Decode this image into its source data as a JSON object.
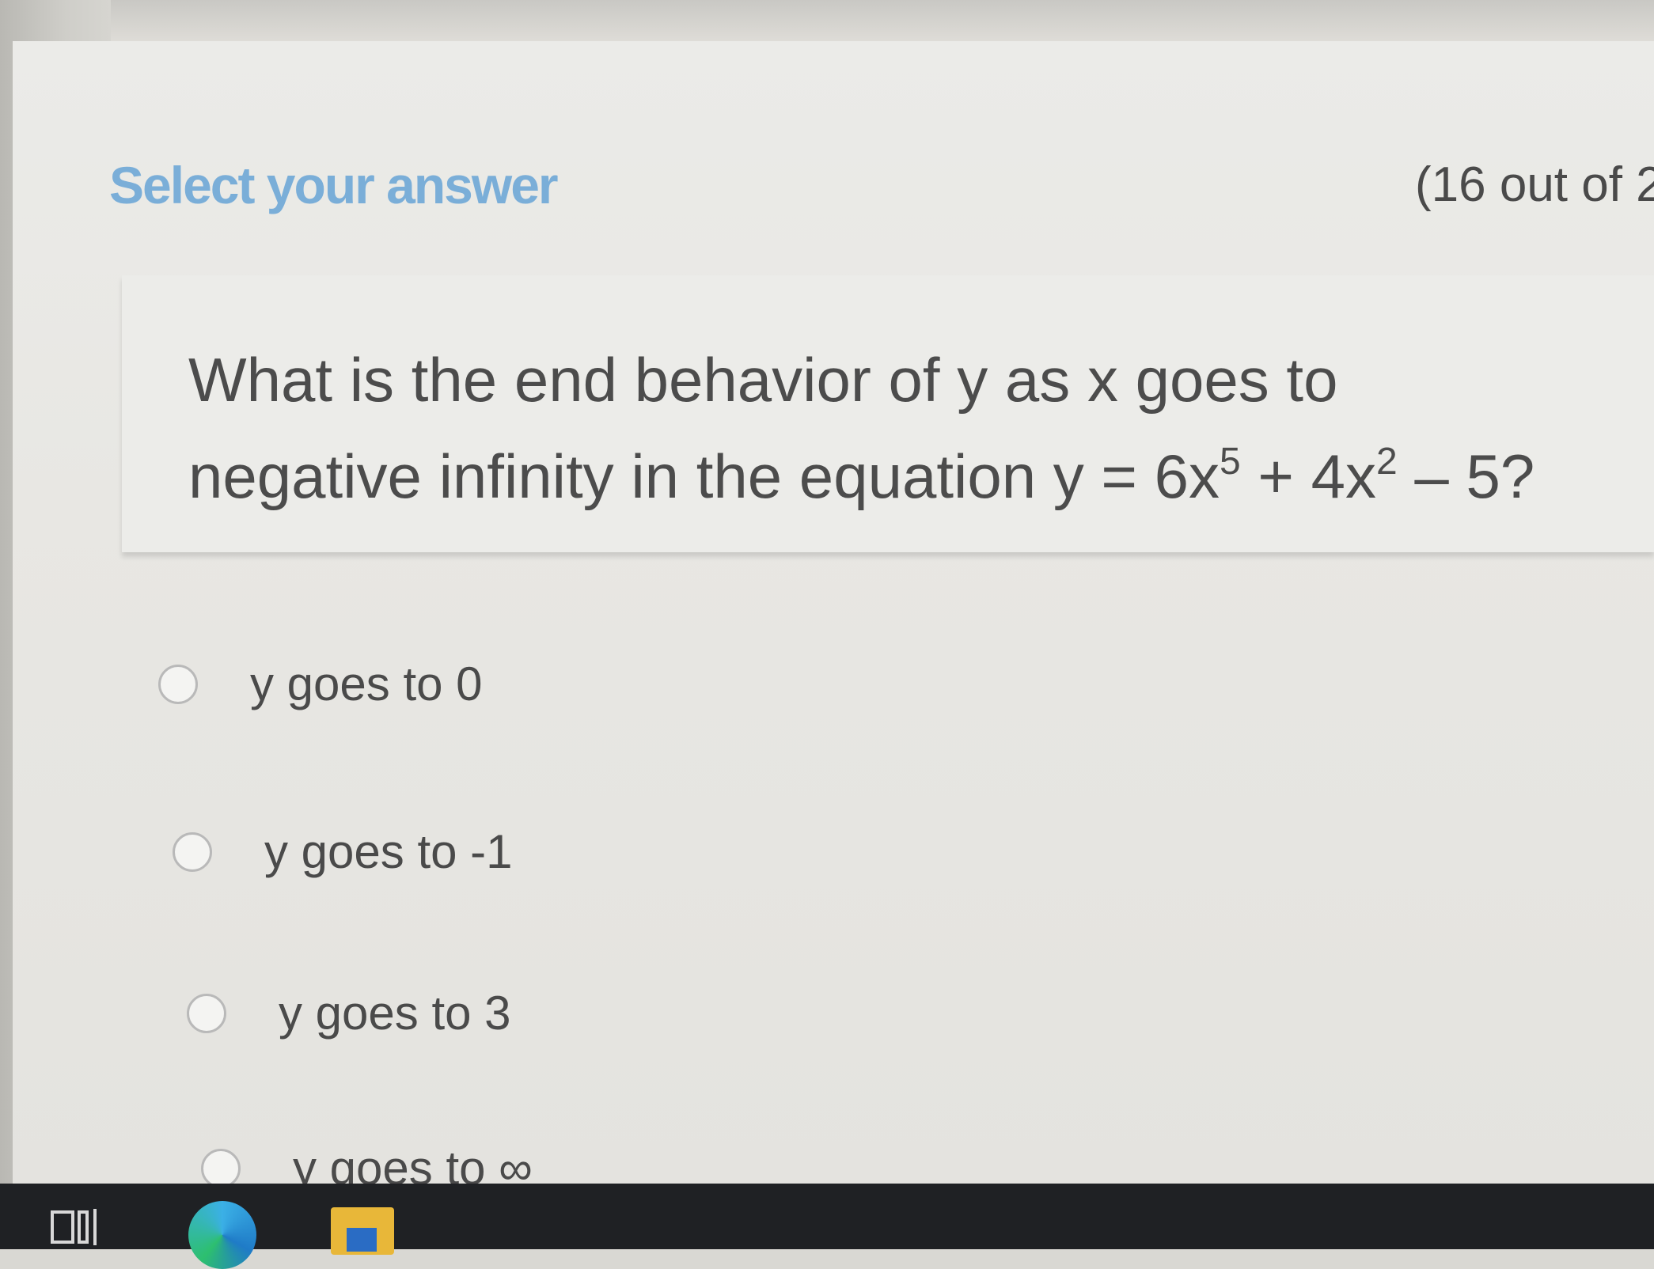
{
  "header": {
    "title": "Select your answer",
    "progress": "(16 out of 2"
  },
  "question": {
    "line1": "What is the end behavior of y as x goes to",
    "line2_pre": "negative infinity in the equation y = 6x",
    "exp1": "5",
    "line2_mid": " + 4x",
    "exp2": "2",
    "line2_post": " – 5?"
  },
  "options": [
    {
      "label": "y goes to 0"
    },
    {
      "label": "y goes to -1"
    },
    {
      "label": "y goes to 3"
    },
    {
      "label": "y goes to ∞"
    }
  ],
  "taskbar": {
    "icons": [
      "task-view-icon",
      "edge-browser-icon",
      "file-explorer-icon"
    ]
  },
  "colors": {
    "title": "#7aaed8",
    "text": "#4a4a4a",
    "taskbar": "#1f2124"
  }
}
